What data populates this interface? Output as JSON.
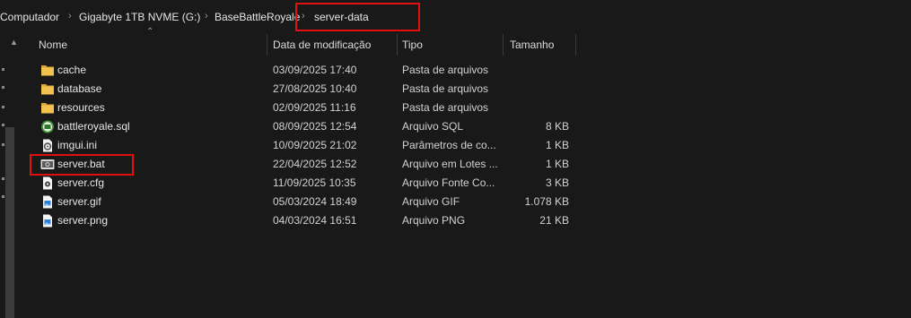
{
  "breadcrumb": {
    "items": [
      "Computador",
      "Gigabyte 1TB NVME (G:)",
      "BaseBattleRoyale",
      "server-data"
    ],
    "separator": "›"
  },
  "columns": {
    "name": "Nome",
    "modified": "Data de modificação",
    "type": "Tipo",
    "size": "Tamanho"
  },
  "files": [
    {
      "name": "cache",
      "modified": "03/09/2025 17:40",
      "type": "Pasta de arquivos",
      "size": "",
      "icon": "folder-icon"
    },
    {
      "name": "database",
      "modified": "27/08/2025 10:40",
      "type": "Pasta de arquivos",
      "size": "",
      "icon": "folder-icon"
    },
    {
      "name": "resources",
      "modified": "02/09/2025 11:16",
      "type": "Pasta de arquivos",
      "size": "",
      "icon": "folder-icon"
    },
    {
      "name": "battleroyale.sql",
      "modified": "08/09/2025 12:54",
      "type": "Arquivo SQL",
      "size": "8 KB",
      "icon": "sql-file-icon"
    },
    {
      "name": "imgui.ini",
      "modified": "10/09/2025 21:02",
      "type": "Parâmetros de co...",
      "size": "1 KB",
      "icon": "settings-file-icon"
    },
    {
      "name": "server.bat",
      "modified": "22/04/2025 12:52",
      "type": "Arquivo em Lotes ...",
      "size": "1 KB",
      "icon": "batch-file-icon"
    },
    {
      "name": "server.cfg",
      "modified": "11/09/2025 10:35",
      "type": "Arquivo Fonte Co...",
      "size": "3 KB",
      "icon": "config-file-icon"
    },
    {
      "name": "server.gif",
      "modified": "05/03/2024 18:49",
      "type": "Arquivo GIF",
      "size": "1.078 KB",
      "icon": "image-file-icon"
    },
    {
      "name": "server.png",
      "modified": "04/03/2024 16:51",
      "type": "Arquivo PNG",
      "size": "21 KB",
      "icon": "image-file-icon"
    }
  ],
  "colors": {
    "background": "#191919",
    "highlight": "#e01010",
    "folder": "#f2c14e"
  }
}
